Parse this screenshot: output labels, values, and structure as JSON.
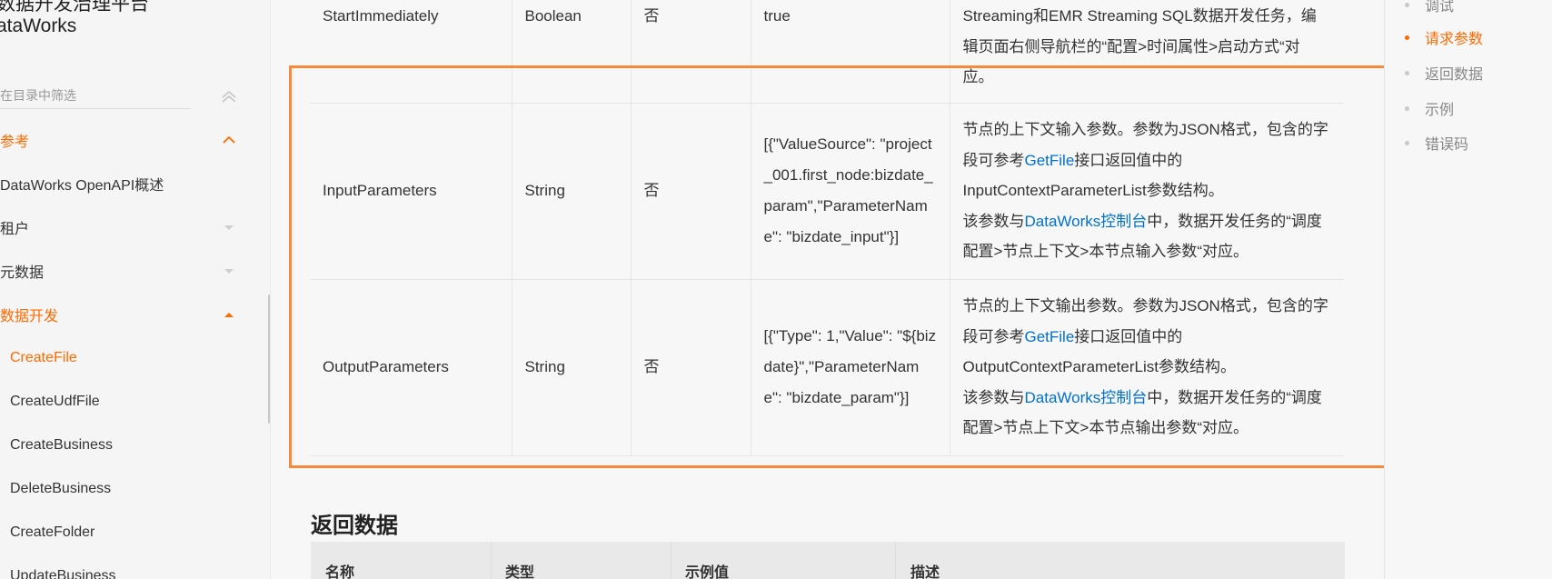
{
  "sidebar": {
    "title_line1": "数据开发治理平台",
    "title_line2": "ataWorks",
    "filter_placeholder": "在目录中筛选",
    "items": [
      {
        "label": "参考",
        "state": "expanded",
        "accent": true
      },
      {
        "label": "DataWorks OpenAPI概述"
      },
      {
        "label": "租户",
        "state": "collapsed"
      },
      {
        "label": "元数据",
        "state": "collapsed"
      },
      {
        "label": "数据开发",
        "state": "expanded",
        "accent": true
      },
      {
        "label": "CreateFile",
        "active": true
      },
      {
        "label": "CreateUdfFile"
      },
      {
        "label": "CreateBusiness"
      },
      {
        "label": "DeleteBusiness"
      },
      {
        "label": "CreateFolder"
      },
      {
        "label": "UpdateBusiness"
      }
    ]
  },
  "params_table": {
    "rows": [
      {
        "name": "StartImmediately",
        "type": "Boolean",
        "required": "否",
        "example": "true",
        "desc_line1": "Streaming和EMR Streaming SQL数据开发任务，编",
        "desc_line2": "辑页面右侧导航栏的“配置>时间属性>启动方式“对",
        "desc_line3": "应。"
      },
      {
        "name": "InputParameters",
        "type": "String",
        "required": "否",
        "example": "[{\"ValueSource\": \"project_001.first_node:bizdate_param\",\"ParameterName\": \"bizdate_input\"}]",
        "desc_a": "节点的上下文输入参数。参数为JSON格式，包含的字段可参考",
        "desc_link1": "GetFile",
        "desc_b": "接口返回值中的InputContextParameterList参数结构。",
        "desc_c": "该参数与",
        "desc_link2": "DataWorks控制台",
        "desc_d": "中，数据开发任务的“调度配置>节点上下文>本节点输入参数“对应。"
      },
      {
        "name": "OutputParameters",
        "type": "String",
        "required": "否",
        "example": "[{\"Type\": 1,\"Value\": \"${bizdate}\",\"ParameterName\": \"bizdate_param\"}]",
        "desc_a": "节点的上下文输出参数。参数为JSON格式，包含的字段可参考",
        "desc_link1": "GetFile",
        "desc_b": "接口返回值中的OutputContextParameterList参数结构。",
        "desc_c": "该参数与",
        "desc_link2": "DataWorks控制台",
        "desc_d": "中，数据开发任务的“调度配置>节点上下文>本节点输出参数“对应。"
      }
    ]
  },
  "response": {
    "heading": "返回数据",
    "columns": [
      "名称",
      "类型",
      "示例值",
      "描述"
    ]
  },
  "toc": {
    "items": [
      {
        "label": "调试"
      },
      {
        "label": "请求参数",
        "active": true
      },
      {
        "label": "返回数据"
      },
      {
        "label": "示例"
      },
      {
        "label": "错误码"
      }
    ]
  },
  "colors": {
    "accent": "#ff6a00",
    "link": "#0070cc",
    "highlight_box": "#f58a3a"
  }
}
